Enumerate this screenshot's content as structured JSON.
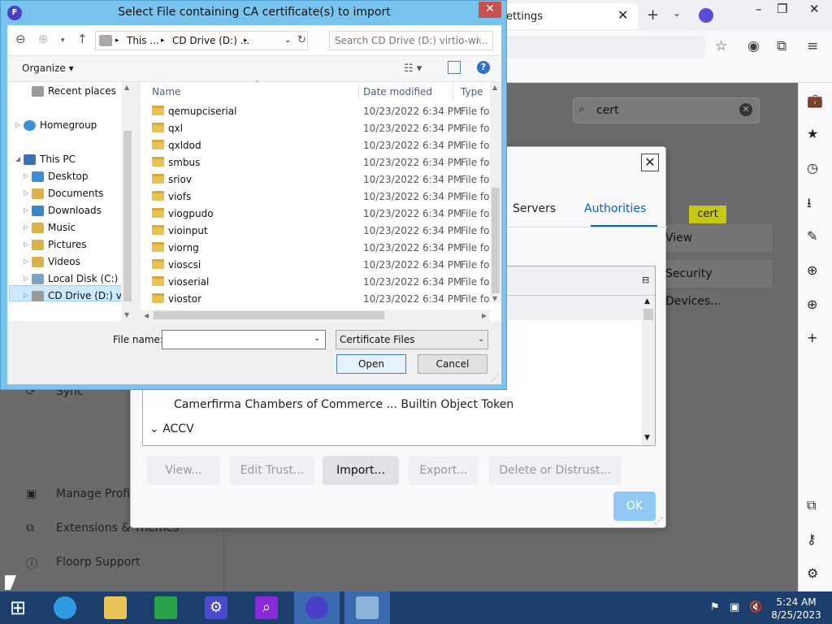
{
  "browser": {
    "tab_title": "ettings",
    "settings_search": "cert",
    "cert_highlight": "cert",
    "view_certs_btn": "View Certificates...",
    "security_devices_btn": "Security Devices...",
    "left_nav": [
      {
        "label": "Sync"
      },
      {
        "label": "Manage Profile"
      },
      {
        "label": "Extensions & Themes"
      },
      {
        "label": "Floorp Support"
      }
    ]
  },
  "cert_manager": {
    "tabs": [
      "Servers",
      "Authorities"
    ],
    "selected_tab": "Authorities",
    "row_cert": "Camerfirma Chambers of Commerce ... Builtin Object Token",
    "row_group": "ACCV",
    "buttons": {
      "view": "View...",
      "edit_trust": "Edit Trust...",
      "import": "Import...",
      "export": "Export...",
      "delete": "Delete or Distrust..."
    },
    "ok": "OK"
  },
  "file_dialog": {
    "title": "Select File containing CA certificate(s) to import",
    "breadcrumb": [
      "This ...",
      "CD Drive (D:) ..."
    ],
    "search_placeholder": "Search CD Drive (D:) virtio-wi...",
    "organize": "Organize",
    "nav": [
      {
        "label": "Recent places"
      },
      {
        "label": "Homegroup"
      },
      {
        "label": "This PC"
      },
      {
        "label": "Desktop"
      },
      {
        "label": "Documents"
      },
      {
        "label": "Downloads"
      },
      {
        "label": "Music"
      },
      {
        "label": "Pictures"
      },
      {
        "label": "Videos"
      },
      {
        "label": "Local Disk (C:)"
      },
      {
        "label": "CD Drive (D:) virt"
      }
    ],
    "columns": {
      "name": "Name",
      "date": "Date modified",
      "type": "Type"
    },
    "files": [
      {
        "name": "qemupciserial",
        "date": "10/23/2022 6:34 PM",
        "type": "File fol"
      },
      {
        "name": "qxl",
        "date": "10/23/2022 6:34 PM",
        "type": "File fol"
      },
      {
        "name": "qxldod",
        "date": "10/23/2022 6:34 PM",
        "type": "File fol"
      },
      {
        "name": "smbus",
        "date": "10/23/2022 6:34 PM",
        "type": "File fol"
      },
      {
        "name": "sriov",
        "date": "10/23/2022 6:34 PM",
        "type": "File fol"
      },
      {
        "name": "viofs",
        "date": "10/23/2022 6:34 PM",
        "type": "File fol"
      },
      {
        "name": "viogpudo",
        "date": "10/23/2022 6:34 PM",
        "type": "File fol"
      },
      {
        "name": "vioinput",
        "date": "10/23/2022 6:34 PM",
        "type": "File fol"
      },
      {
        "name": "viorng",
        "date": "10/23/2022 6:34 PM",
        "type": "File fol"
      },
      {
        "name": "vioscsi",
        "date": "10/23/2022 6:34 PM",
        "type": "File fol"
      },
      {
        "name": "vioserial",
        "date": "10/23/2022 6:34 PM",
        "type": "File fol"
      },
      {
        "name": "viostor",
        "date": "10/23/2022 6:34 PM",
        "type": "File fol"
      }
    ],
    "file_name_label": "File name:",
    "file_name_value": "",
    "file_type": "Certificate Files",
    "open": "Open",
    "cancel": "Cancel"
  },
  "taskbar": {
    "time": "5:24 AM",
    "date": "8/25/2023"
  }
}
